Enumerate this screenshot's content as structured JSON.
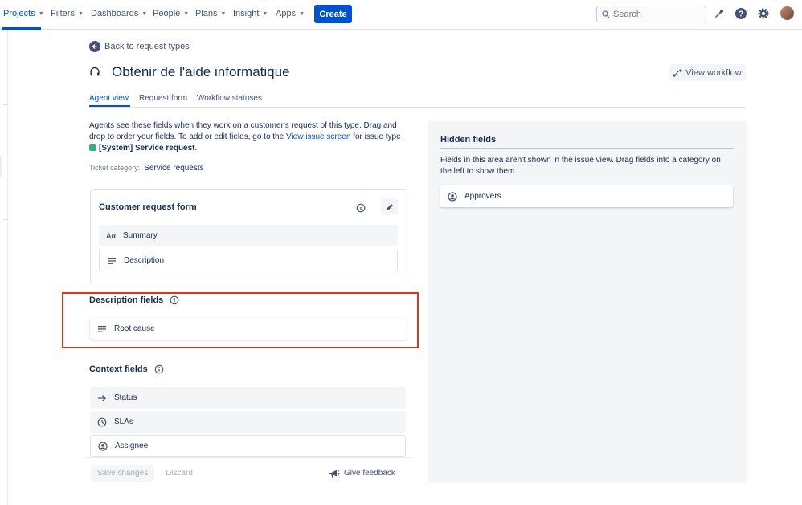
{
  "nav": {
    "items": [
      "Projects",
      "Filters",
      "Dashboards",
      "People",
      "Plans",
      "Insight",
      "Apps"
    ],
    "create_label": "Create",
    "search_placeholder": "Search"
  },
  "page": {
    "back_label": "Back to request types",
    "title": "Obtenir de l'aide informatique",
    "view_workflow_label": "View workflow",
    "tabs": [
      "Agent view",
      "Request form",
      "Workflow statuses"
    ],
    "description_part1": "Agents see these fields when they work on a customer's request of this type. Drag and drop to order your fields. To add or edit fields, go to the ",
    "description_link": "View issue screen",
    "description_part2": " for issue type ",
    "issue_type": "[System] Service request",
    "description_end": ".",
    "ticket_category_label": "Ticket category:",
    "ticket_category_value": "Service requests"
  },
  "customer_request_form": {
    "title": "Customer request form",
    "fields": [
      {
        "label": "Summary",
        "icon": "text-format-icon"
      },
      {
        "label": "Description",
        "icon": "paragraph-icon"
      }
    ]
  },
  "description_fields": {
    "title": "Description fields",
    "fields": [
      {
        "label": "Root cause",
        "icon": "paragraph-icon"
      }
    ]
  },
  "context_fields": {
    "title": "Context fields",
    "fields": [
      {
        "label": "Status",
        "icon": "arrow-right-icon"
      },
      {
        "label": "SLAs",
        "icon": "clock-icon"
      },
      {
        "label": "Assignee",
        "icon": "person-circle-icon"
      }
    ]
  },
  "footer": {
    "save_label": "Save changes",
    "discard_label": "Discard",
    "feedback_label": "Give feedback"
  },
  "hidden_fields": {
    "title": "Hidden fields",
    "description": "Fields in this area aren't shown in the issue view. Drag fields into a category on the left to show them.",
    "fields": [
      {
        "label": "Approvers",
        "icon": "person-circle-icon"
      }
    ]
  },
  "colors": {
    "brand": "#0052cc",
    "highlight_box": "#e0341e",
    "system_badge": "#36b37e"
  }
}
